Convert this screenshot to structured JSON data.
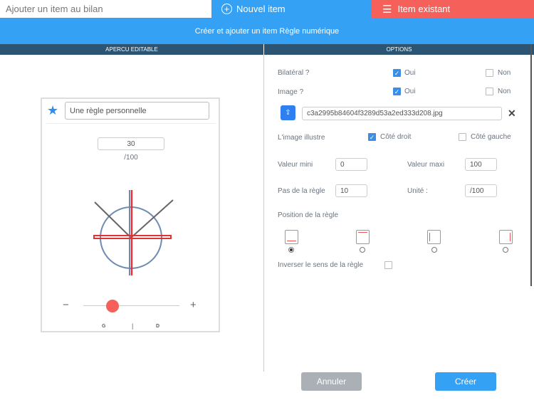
{
  "tabs": {
    "add_label": "Ajouter un item au bilan",
    "new_label": "Nouvel item",
    "existing_label": "Item existant"
  },
  "banner": "Créer et ajouter un item Règle numérique",
  "sections": {
    "preview": "APERCU EDITABLE",
    "options": "OPTIONS"
  },
  "preview": {
    "name_value": "Une règle personnelle",
    "score_value": "30",
    "unit": "/100",
    "slider_value": 30,
    "slider_min": 0,
    "slider_max": 100,
    "minus": "−",
    "plus": "+",
    "left_label": "G",
    "sep": "|",
    "right_label": "D"
  },
  "options": {
    "bilateral_label": "Bilatéral ?",
    "image_label": "Image ?",
    "yes": "Oui",
    "no": "Non",
    "file_name": "c3a2995b84604f3289d53a2ed333d208.jpg",
    "illustrates_label": "L'image illustre",
    "right_side": "Côté droit",
    "left_side": "Côté gauche",
    "min_label": "Valeur mini",
    "min_value": "0",
    "max_label": "Valeur maxi",
    "max_value": "100",
    "step_label": "Pas de la règle",
    "step_value": "10",
    "unit_label": "Unité :",
    "unit_value": "/100",
    "position_label": "Position de la règle",
    "invert_label": "Inverser le sens de la règle"
  },
  "buttons": {
    "cancel": "Annuler",
    "create": "Créer"
  },
  "colors": {
    "blue": "#35a1f5",
    "red": "#f5605a",
    "dark": "#2b5573"
  }
}
